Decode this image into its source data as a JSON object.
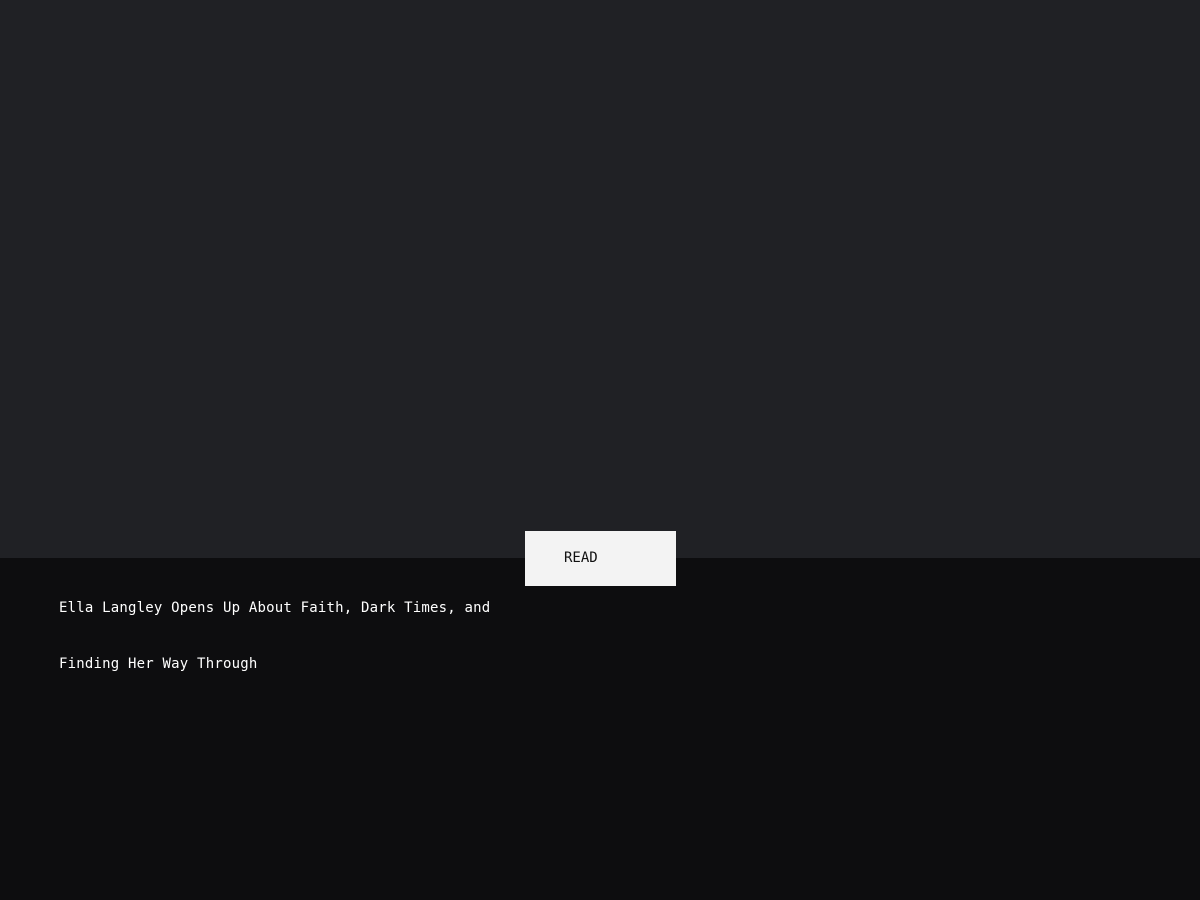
{
  "hero": {
    "background_color": "#202125"
  },
  "panel": {
    "background_color": "#0d0d0f"
  },
  "read_button": {
    "label": "READ",
    "background_color": "#f3f3f3"
  },
  "article": {
    "headline": "Ella Langley Opens Up About Faith, Dark Times, and Finding Her Way Through"
  }
}
